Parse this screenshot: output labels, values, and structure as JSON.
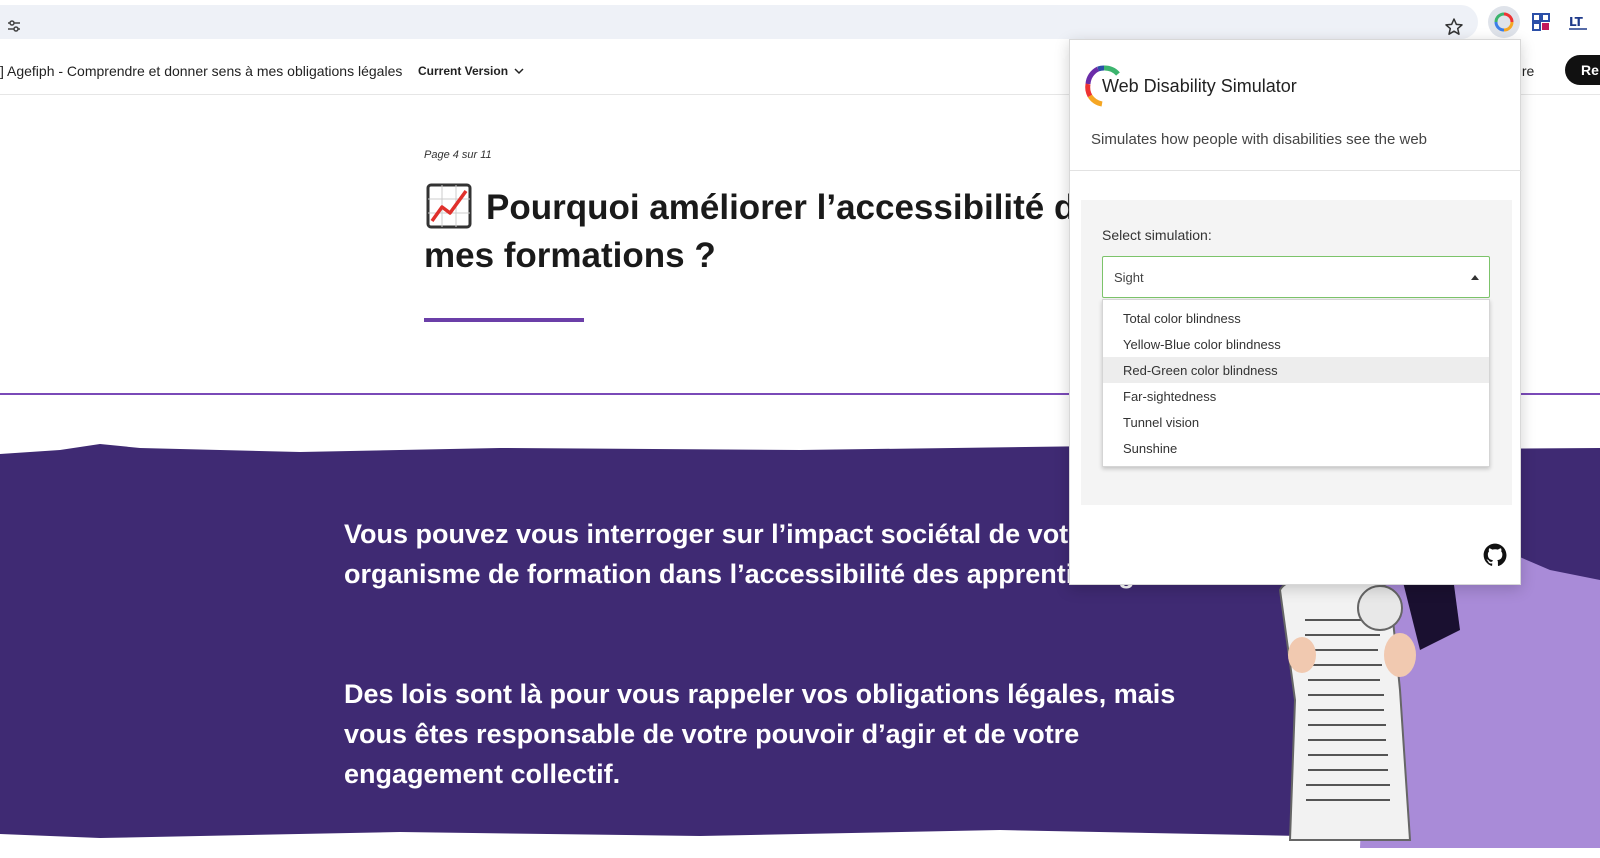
{
  "browser": {
    "icons": [
      "tune-icon",
      "star-icon",
      "web-disability-simulator-extension-icon",
      "grid-extension-icon",
      "translate-extension-icon"
    ]
  },
  "header": {
    "course_title": "] Agefiph - Comprendre et donner sens à mes obligations légales",
    "version_label": "Current Version",
    "right_text": "ıre",
    "button_label": "Re"
  },
  "main": {
    "page_counter": "Page 4 sur 11",
    "heading": "Pourquoi améliorer l’accessibilité de mes formations ?",
    "heading_icon": "chart-increasing-icon",
    "accent_color": "#6b3fa8"
  },
  "band": {
    "paragraph1": "Vous pouvez vous interroger sur l’impact sociétal de votre organisme de formation dans l’accessibilité des apprentissages.",
    "paragraph2": "Des lois sont là pour vous rappeler vos obligations légales, mais vous êtes responsable de votre pouvoir d’agir et de votre engagement collectif.",
    "background_color": "#3f2a73"
  },
  "popup": {
    "title": "Web Disability Simulator",
    "subtitle": "Simulates how people with disabilities see the web",
    "select_label": "Select simulation:",
    "selected_value": "Sight",
    "options": [
      {
        "label": "Total color blindness"
      },
      {
        "label": "Yellow-Blue color blindness"
      },
      {
        "label": "Red-Green color blindness"
      },
      {
        "label": "Far-sightedness"
      },
      {
        "label": "Tunnel vision"
      },
      {
        "label": "Sunshine"
      }
    ],
    "hovered_option": "Red-Green color blindness",
    "select_border_color": "#7cc36a"
  }
}
